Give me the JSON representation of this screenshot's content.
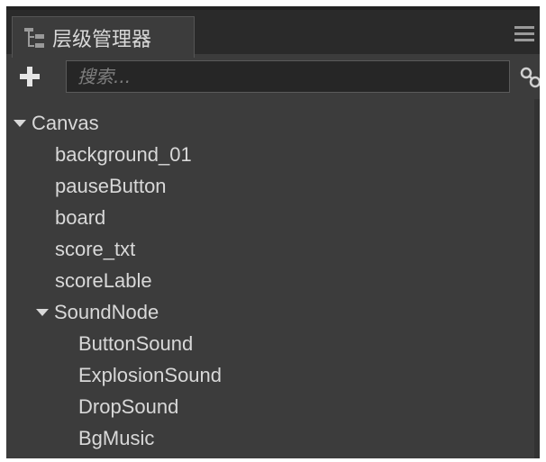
{
  "panel": {
    "title": "层级管理器",
    "icons": {
      "tab": "hierarchy-icon",
      "menu": "menu-icon",
      "add": "plus-icon",
      "link": "link-icon"
    }
  },
  "search": {
    "placeholder": "搜索..."
  },
  "tree": {
    "root": {
      "label": "Canvas",
      "expanded": true
    },
    "children": [
      {
        "label": "background_01"
      },
      {
        "label": "pauseButton"
      },
      {
        "label": "board"
      },
      {
        "label": "score_txt"
      },
      {
        "label": "scoreLable"
      },
      {
        "label": "SoundNode",
        "expanded": true,
        "children": [
          {
            "label": "ButtonSound"
          },
          {
            "label": "ExplosionSound"
          },
          {
            "label": "DropSound"
          },
          {
            "label": "BgMusic"
          }
        ]
      }
    ]
  },
  "colors": {
    "panel_bg": "#3c3c3c",
    "tabbar_bg": "#2a2a2a",
    "text": "#d8d8d8",
    "search_bg": "#262626"
  }
}
